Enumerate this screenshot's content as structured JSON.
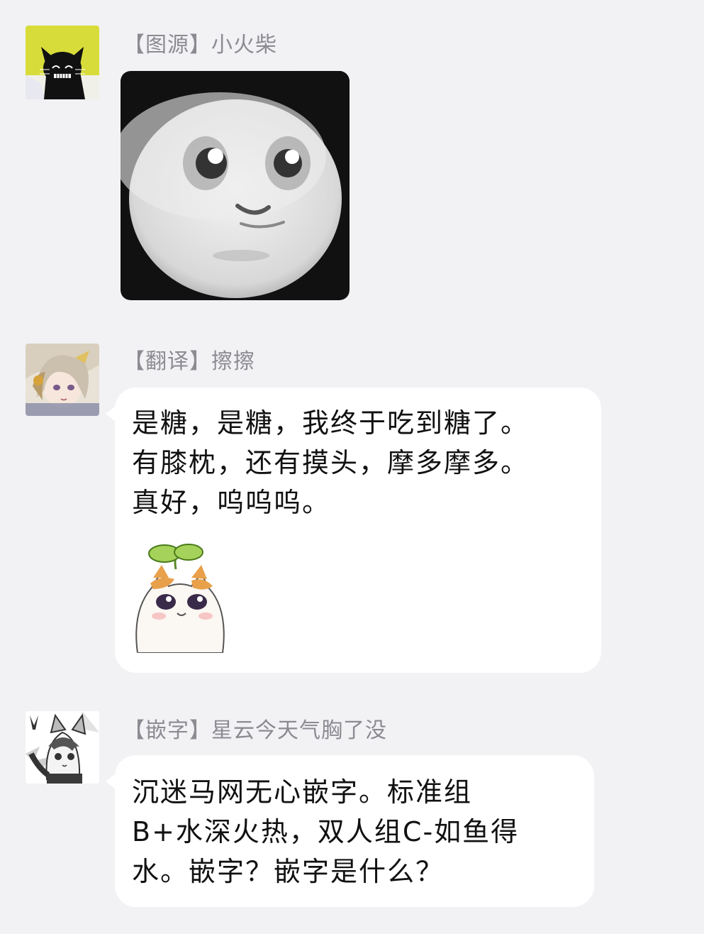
{
  "messages": [
    {
      "avatar_icon": "black-cat-avatar-icon",
      "sender": "【图源】小火柴",
      "sticker_icon": "panda-face-sticker-icon"
    },
    {
      "avatar_icon": "anime-character-avatar-icon",
      "sender": "【翻译】擦擦",
      "text": "是糖，是糖，我终于吃到糖了。\n有膝枕，还有摸头，摩多摩多。\n真好，呜呜呜。",
      "sticker_icon": "sprout-cat-sticker-icon"
    },
    {
      "avatar_icon": "fox-girl-avatar-icon",
      "sender": "【嵌字】星云今天气胸了没",
      "text": "沉迷马网无心嵌字。标准组\nB+水深火热，双人组C-如鱼得\n水。嵌字？嵌字是什么？"
    }
  ],
  "colors": {
    "background": "#f2f2f5",
    "bubble": "#ffffff",
    "sender_text": "#8b8b92",
    "message_text": "#111111"
  }
}
